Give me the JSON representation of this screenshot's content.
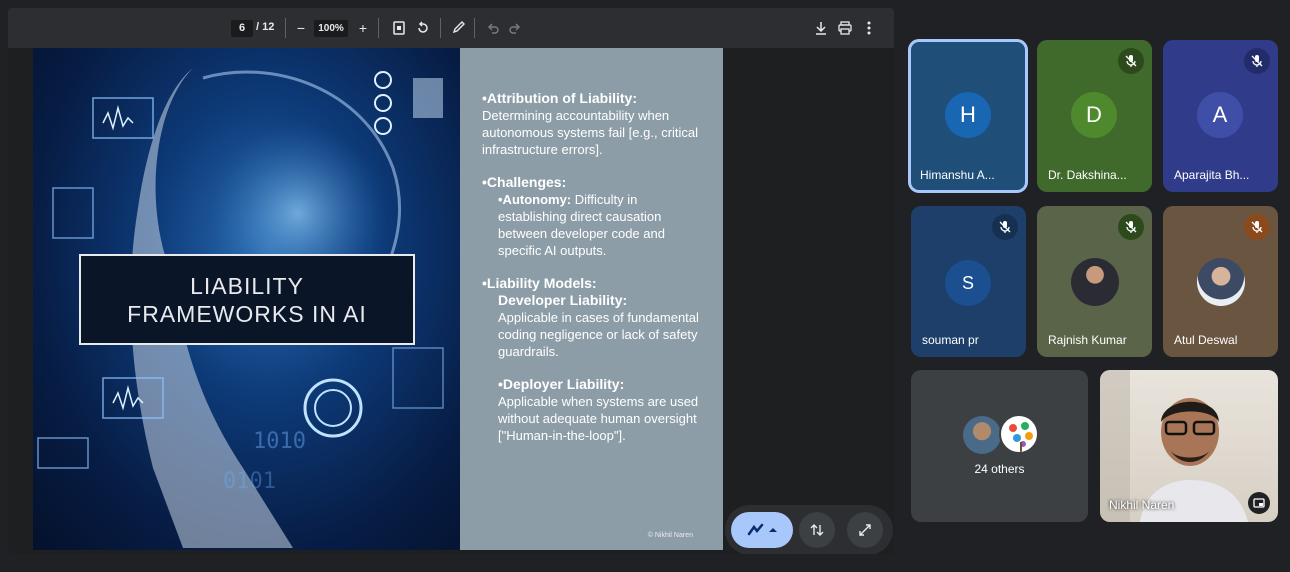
{
  "pdf_toolbar": {
    "current_page": "6",
    "total_pages": "/ 12",
    "zoom_out_label": "−",
    "zoom": "100%",
    "zoom_in_label": "+"
  },
  "slide": {
    "title_line1": "LIABILITY",
    "title_line2": "FRAMEWORKS IN AI",
    "attribution_head": "•Attribution of Liability:",
    "attribution_body": "Determining accountability when autonomous systems fail [e.g., critical infrastructure errors].",
    "challenges_head": "•Challenges:",
    "autonomy_head": "•Autonomy:",
    "autonomy_body": " Difficulty in establishing direct causation between developer code and specific AI outputs.",
    "models_head": "•Liability Models:",
    "developer_head": "Developer Liability:",
    "developer_body": "Applicable in cases of fundamental coding negligence or lack of safety guardrails.",
    "deployer_head": "•Deployer Liability:",
    "deployer_body": "Applicable when systems are used without adequate human oversight [\"Human-in-the-loop\"].",
    "copyright": "© Nikhil Naren"
  },
  "participants": [
    {
      "name": "Himanshu A...",
      "initial": "H",
      "muted": false,
      "bg": "#1f4e79",
      "avatar": "#1967b2"
    },
    {
      "name": "Dr. Dakshina...",
      "initial": "D",
      "muted": true,
      "bg": "#3f6a2b",
      "avatar": "#4e8a2d"
    },
    {
      "name": "Aparajita Bh...",
      "initial": "A",
      "muted": true,
      "bg": "#303c8a",
      "avatar": "#3f4fa8"
    },
    {
      "name": "souman pr",
      "initial": "S",
      "muted": true,
      "bg": "#1e3f6a",
      "avatar": "#1b4f8f"
    },
    {
      "name": "Rajnish Kumar",
      "muted": true,
      "bg": "#5a6448"
    },
    {
      "name": "Atul Deswal",
      "muted": true,
      "bg": "#6a5541"
    }
  ],
  "others": {
    "label": "24 others"
  },
  "self_tile": {
    "name": "Nikhil Naren"
  },
  "colors": {
    "accent": "#a8c7fa",
    "mute_icon": "#ffffff"
  }
}
